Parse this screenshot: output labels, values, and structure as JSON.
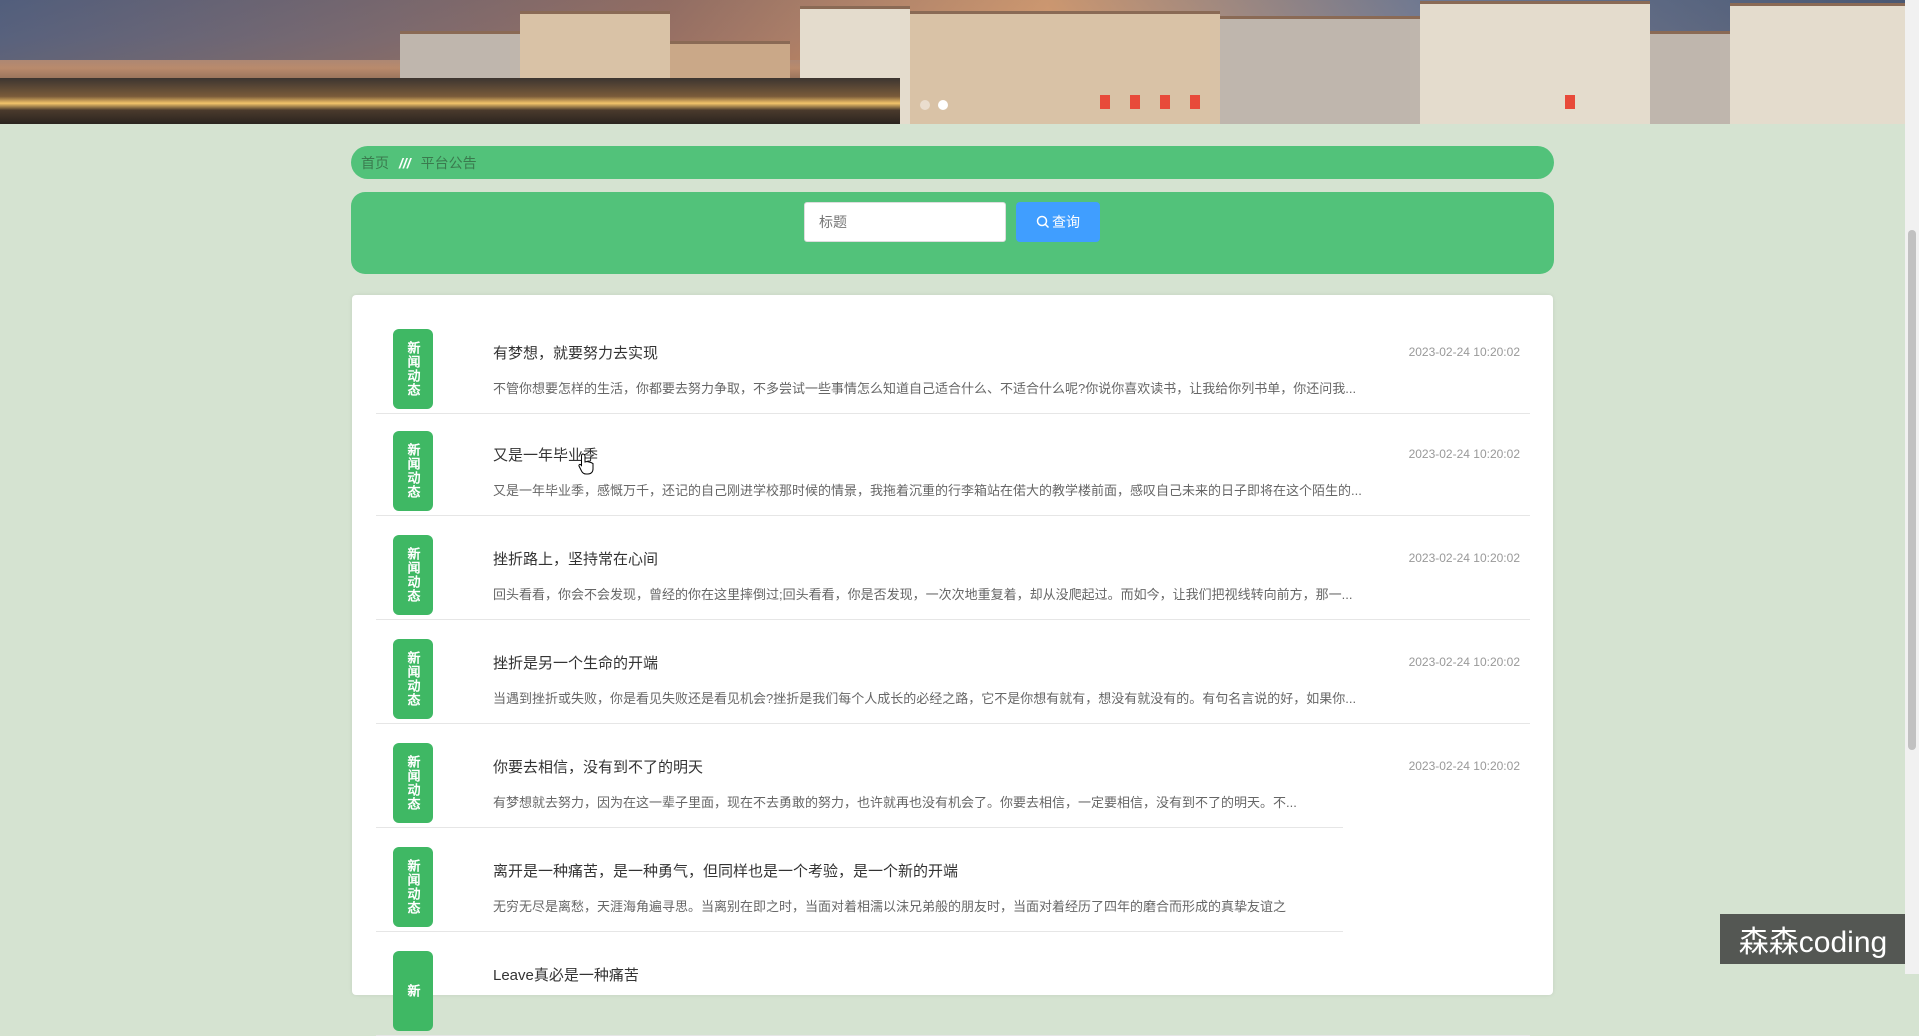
{
  "breadcrumb": {
    "home": "首页",
    "separator": "///",
    "current": "平台公告"
  },
  "search": {
    "placeholder": "标题",
    "button_label": "查询",
    "button_icon": "search-icon"
  },
  "news": [
    {
      "badge": "新闻动态",
      "title": "有梦想，就要努力去实现",
      "date": "2023-02-24 10:20:02",
      "excerpt": "不管你想要怎样的生活，你都要去努力争取，不多尝试一些事情怎么知道自己适合什么、不适合什么呢?你说你喜欢读书，让我给你列书单，你还问我..."
    },
    {
      "badge": "新闻动态",
      "title": "又是一年毕业季",
      "date": "2023-02-24 10:20:02",
      "excerpt": "又是一年毕业季，感慨万千，还记的自己刚进学校那时候的情景，我拖着沉重的行李箱站在偌大的教学楼前面，感叹自己未来的日子即将在这个陌生的..."
    },
    {
      "badge": "新闻动态",
      "title": "挫折路上，坚持常在心间",
      "date": "2023-02-24 10:20:02",
      "excerpt": "回头看看，你会不会发现，曾经的你在这里摔倒过;回头看看，你是否发现，一次次地重复着，却从没爬起过。而如今，让我们把视线转向前方，那一..."
    },
    {
      "badge": "新闻动态",
      "title": "挫折是另一个生命的开端",
      "date": "2023-02-24 10:20:02",
      "excerpt": "当遇到挫折或失败，你是看见失败还是看见机会?挫折是我们每个人成长的必经之路，它不是你想有就有，想没有就没有的。有句名言说的好，如果你..."
    },
    {
      "badge": "新闻动态",
      "title": "你要去相信，没有到不了的明天",
      "date": "2023-02-24 10:20:02",
      "excerpt": "有梦想就去努力，因为在这一辈子里面，现在不去勇敢的努力，也许就再也没有机会了。你要去相信，一定要相信，没有到不了的明天。不..."
    },
    {
      "badge": "新闻动态",
      "title": "离开是一种痛苦，是一种勇气，但同样也是一个考验，是一个新的开端",
      "date": "",
      "excerpt": "无穷无尽是离愁，天涯海角遍寻思。当离别在即之时，当面对着相濡以沫兄弟般的朋友时，当面对着经历了四年的磨合而形成的真挚友谊之"
    },
    {
      "badge": "新",
      "title": "Leave真必是一种痛苦",
      "date": "",
      "excerpt": ""
    }
  ],
  "watermark": "森森coding"
}
